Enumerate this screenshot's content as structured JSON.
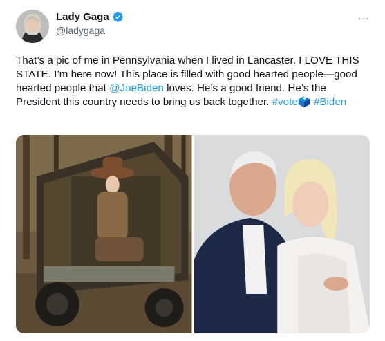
{
  "author": {
    "display_name": "Lady Gaga",
    "handle": "@ladygaga",
    "verified": true,
    "avatar_icon": "avatar-photo"
  },
  "menu": {
    "more_label": "···",
    "icon": "more-horizontal-icon"
  },
  "tweet": {
    "text_parts": [
      "That’s a pic of me in Pennsylvania when I lived in Lancaster. I LOVE THIS STATE. I’m here now! This place is filled with good hearted people—good hearted people that ",
      " loves. He’s a good friend. He’s the President this country needs to bring us back together. "
    ],
    "mention": "@JoeBiden",
    "hashtag_vote": "#vote",
    "ballot_emoji": "🗳️",
    "hashtag_biden": "#Biden"
  },
  "colors": {
    "link": "#1d9bf0",
    "verified": "#1d9bf0",
    "secondary_text": "#536471"
  },
  "media": [
    {
      "name": "photo-atv-woods",
      "icon": "photo"
    },
    {
      "name": "photo-portrait-embrace",
      "icon": "photo"
    }
  ]
}
